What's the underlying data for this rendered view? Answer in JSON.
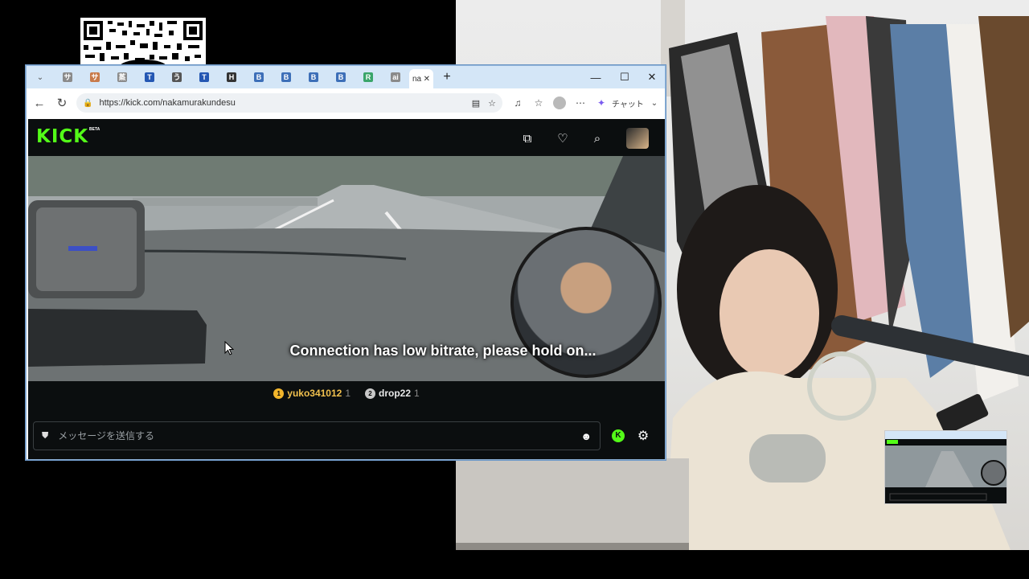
{
  "browser": {
    "tabs_mini": [
      {
        "glyph": "サ",
        "color": "#8a8a8a"
      },
      {
        "glyph": "サ",
        "color": "#c87a4a"
      },
      {
        "glyph": "蒸",
        "color": "#8a8a8a"
      },
      {
        "glyph": "T",
        "color": "#2457b3"
      },
      {
        "glyph": "う",
        "color": "#555555"
      },
      {
        "glyph": "T",
        "color": "#2457b3"
      },
      {
        "glyph": "H",
        "color": "#333333"
      },
      {
        "glyph": "B",
        "color": "#3d6fb8"
      },
      {
        "glyph": "B",
        "color": "#3d6fb8"
      },
      {
        "glyph": "B",
        "color": "#3d6fb8"
      },
      {
        "glyph": "B",
        "color": "#3d6fb8"
      },
      {
        "glyph": "R",
        "color": "#3aa56a"
      },
      {
        "glyph": "ai",
        "color": "#8a8a8a"
      }
    ],
    "active_tab_label": "na",
    "url": "https://kick.com/nakamurakundesu",
    "chat_label": "チャット"
  },
  "kick": {
    "logo": "KICK",
    "beta": "BETA",
    "brand_color": "#53fc18",
    "video_overlay": "Connection has low bitrate, please hold on...",
    "leaderboard": [
      {
        "rank": "1",
        "name": "yuko341012",
        "count": "1",
        "rank_color": "#f2b52b",
        "name_color": "#f2c14e"
      },
      {
        "rank": "2",
        "name": "drop22",
        "count": "1",
        "rank_color": "#c8c8c8",
        "name_color": "#e8e8e8"
      }
    ],
    "chat_placeholder": "メッセージを送信する"
  }
}
